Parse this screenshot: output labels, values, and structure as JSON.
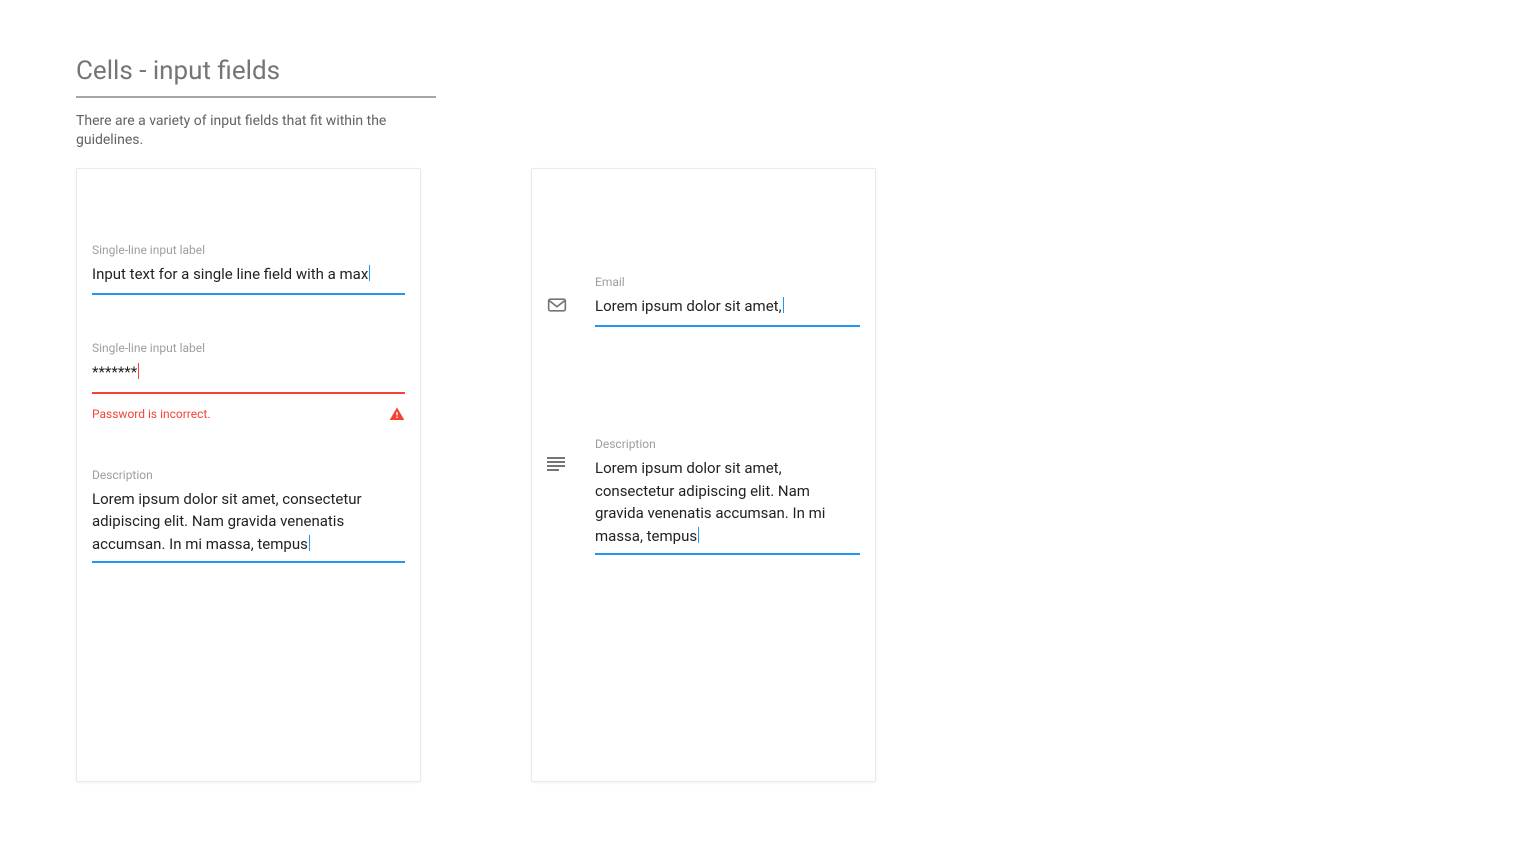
{
  "page": {
    "title": "Cells - input fields",
    "description": "There are a variety of input fields that fit within the guidelines."
  },
  "left_card": {
    "single_line": {
      "label": "Single-line input label",
      "value": "Input text for a single line field with a max"
    },
    "password": {
      "label": "Single-line input label",
      "value": "*******",
      "error_message": "Password is incorrect.",
      "error_icon_name": "warning"
    },
    "description": {
      "label": "Description",
      "value": "Lorem ipsum dolor sit amet, consectetur adipiscing elit. Nam gravida venenatis accumsan. In mi massa, tempus"
    }
  },
  "right_card": {
    "email": {
      "icon_name": "email",
      "label": "Email",
      "value": "Lorem ipsum dolor sit amet,"
    },
    "description": {
      "icon_name": "text-lines",
      "label": "Description",
      "value": "Lorem ipsum dolor sit amet, consectetur adipiscing elit. Nam gravida venenatis accumsan. In mi massa, tempus"
    }
  },
  "colors": {
    "accent": "#2196f3",
    "error": "#f44336",
    "label": "#9e9e9e",
    "title": "#757575"
  }
}
